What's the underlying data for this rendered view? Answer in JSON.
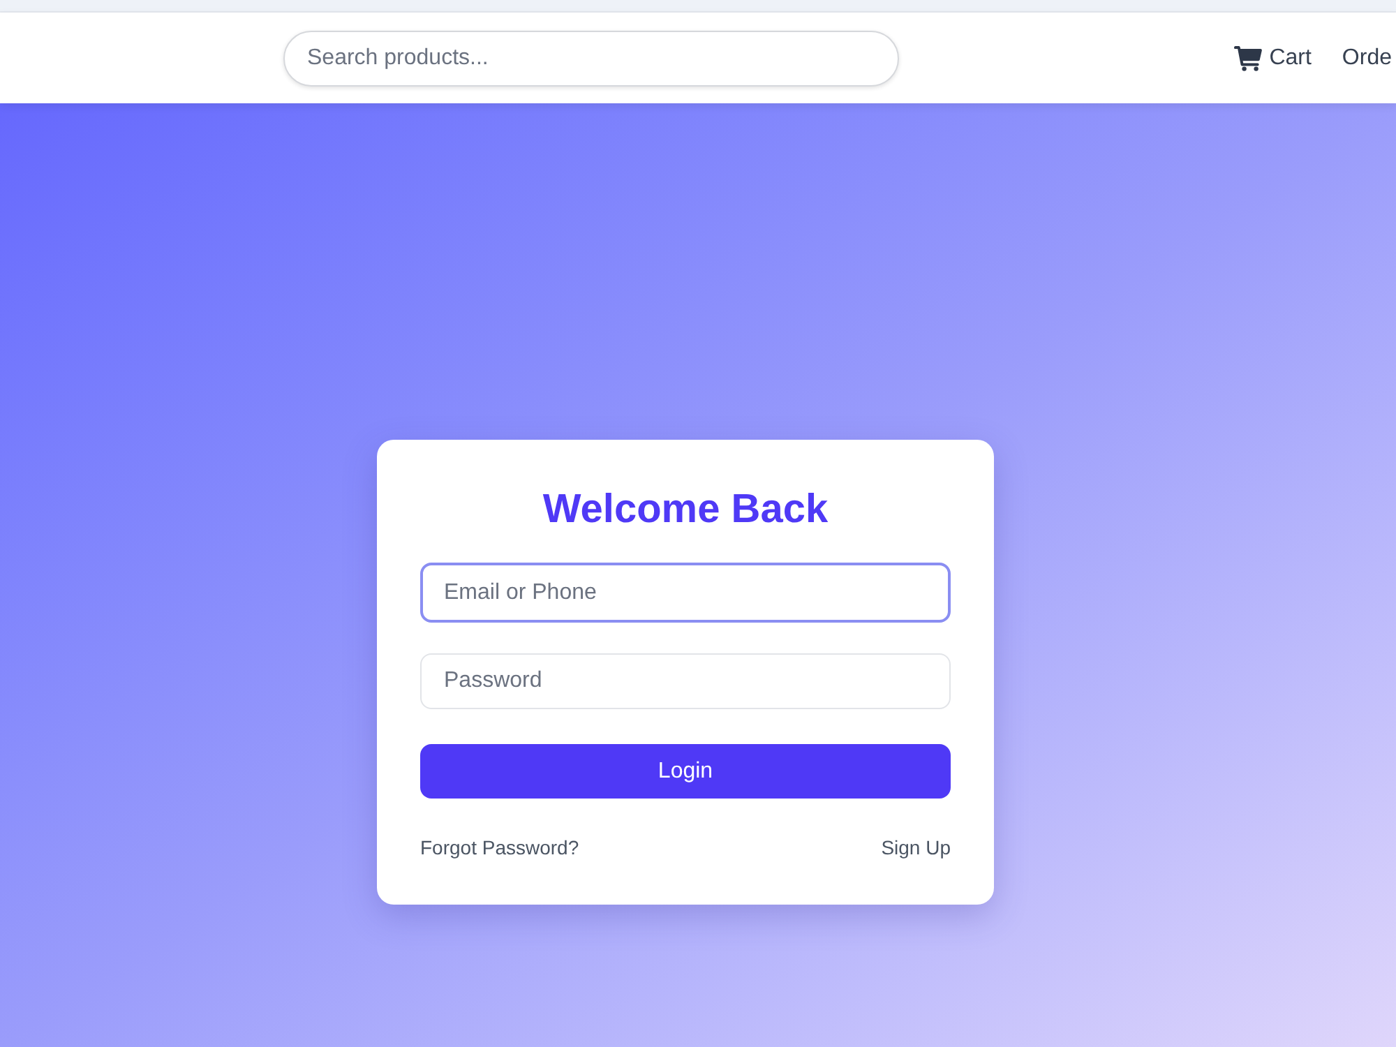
{
  "header": {
    "search": {
      "placeholder": "Search products..."
    },
    "nav": [
      {
        "kind": "cart",
        "label": "Cart"
      },
      {
        "kind": "link",
        "label": "Orde"
      }
    ]
  },
  "login_card": {
    "title": "Welcome Back",
    "fields": [
      {
        "placeholder": "Email or Phone",
        "focused": true
      },
      {
        "placeholder": "Password",
        "focused": false
      }
    ],
    "submit": "Login",
    "links": [
      "Forgot Password?",
      "Sign Up"
    ]
  }
}
